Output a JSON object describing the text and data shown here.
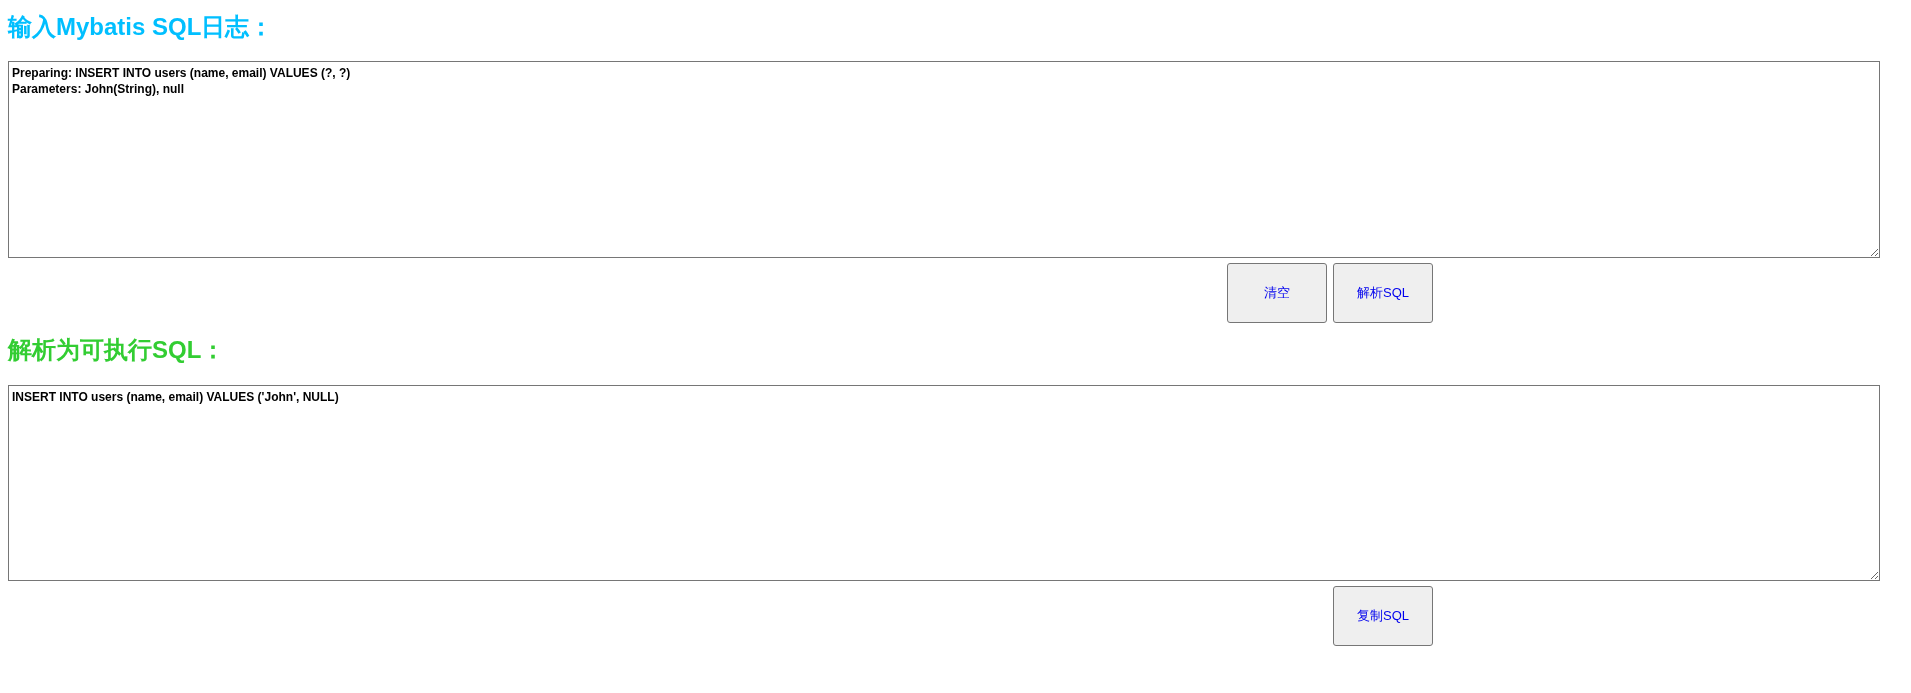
{
  "sections": [
    {
      "heading": "输入Mybatis SQL日志：",
      "color": "#00bfff",
      "textarea": {
        "value": "Preparing: INSERT INTO users (name, email) VALUES (?, ?)\nParameters: John(String), null"
      },
      "buttons": [
        "清空",
        "解析SQL"
      ]
    },
    {
      "heading": "解析为可执行SQL：",
      "color": "#32cd32",
      "textarea": {
        "value": "INSERT INTO users (name, email) VALUES ('John', NULL)"
      },
      "buttons": [
        "复制SQL"
      ]
    }
  ]
}
